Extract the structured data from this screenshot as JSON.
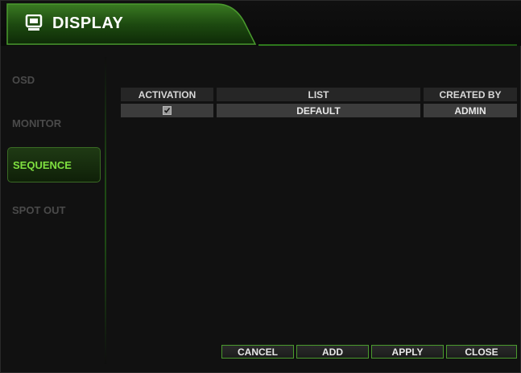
{
  "window": {
    "title": "DISPLAY",
    "icon": "monitor-icon"
  },
  "sidebar": {
    "items": [
      {
        "label": "OSD",
        "active": false
      },
      {
        "label": "MONITOR",
        "active": false
      },
      {
        "label": "SEQUENCE",
        "active": true
      },
      {
        "label": "SPOT OUT",
        "active": false
      }
    ]
  },
  "table": {
    "headers": {
      "activation": "ACTIVATION",
      "list": "LIST",
      "created_by": "CREATED BY"
    },
    "rows": [
      {
        "activation": true,
        "list": "DEFAULT",
        "created_by": "ADMIN"
      }
    ]
  },
  "buttons": {
    "cancel": "CANCEL",
    "add": "ADD",
    "apply": "APPLY",
    "close": "CLOSE"
  },
  "colors": {
    "accent": "#7fe040",
    "border_green": "#4a9a2e"
  }
}
